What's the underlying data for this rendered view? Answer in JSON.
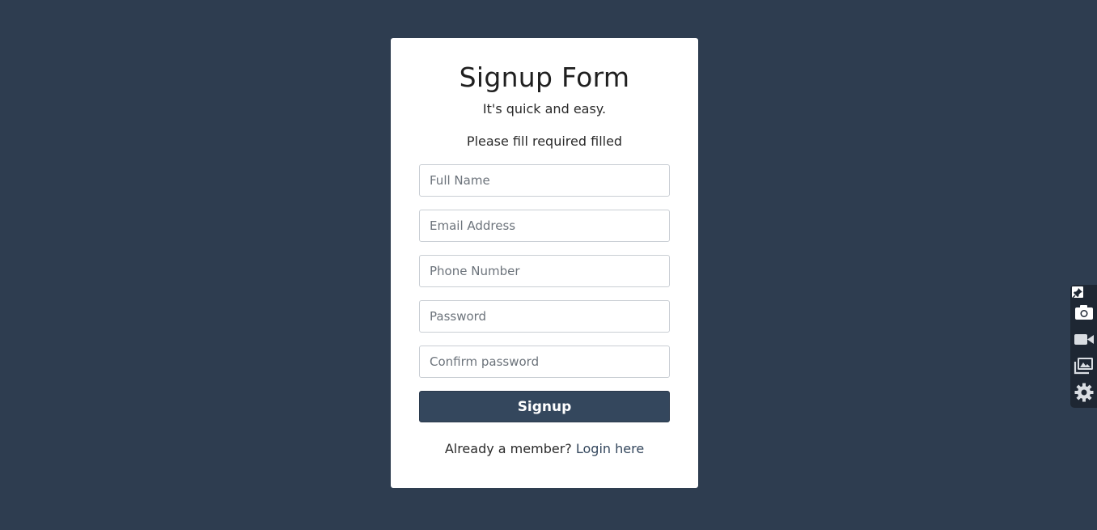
{
  "form": {
    "title": "Signup Form",
    "subtitle": "It's quick and easy.",
    "notice": "Please fill required filled",
    "fields": [
      {
        "placeholder": "Full Name",
        "type": "text"
      },
      {
        "placeholder": "Email Address",
        "type": "email"
      },
      {
        "placeholder": "Phone Number",
        "type": "tel"
      },
      {
        "placeholder": "Password",
        "type": "password"
      },
      {
        "placeholder": "Confirm password",
        "type": "password"
      }
    ],
    "submit_label": "Signup",
    "footer_text": "Already a member?",
    "login_link": "Login here"
  },
  "toolbar": {
    "items": [
      "pin-icon",
      "camera-icon",
      "video-icon",
      "gallery-icon",
      "gear-icon"
    ]
  },
  "colors": {
    "background": "#2e3d50",
    "card": "#ffffff",
    "button": "#34475d",
    "link": "#34475d"
  }
}
